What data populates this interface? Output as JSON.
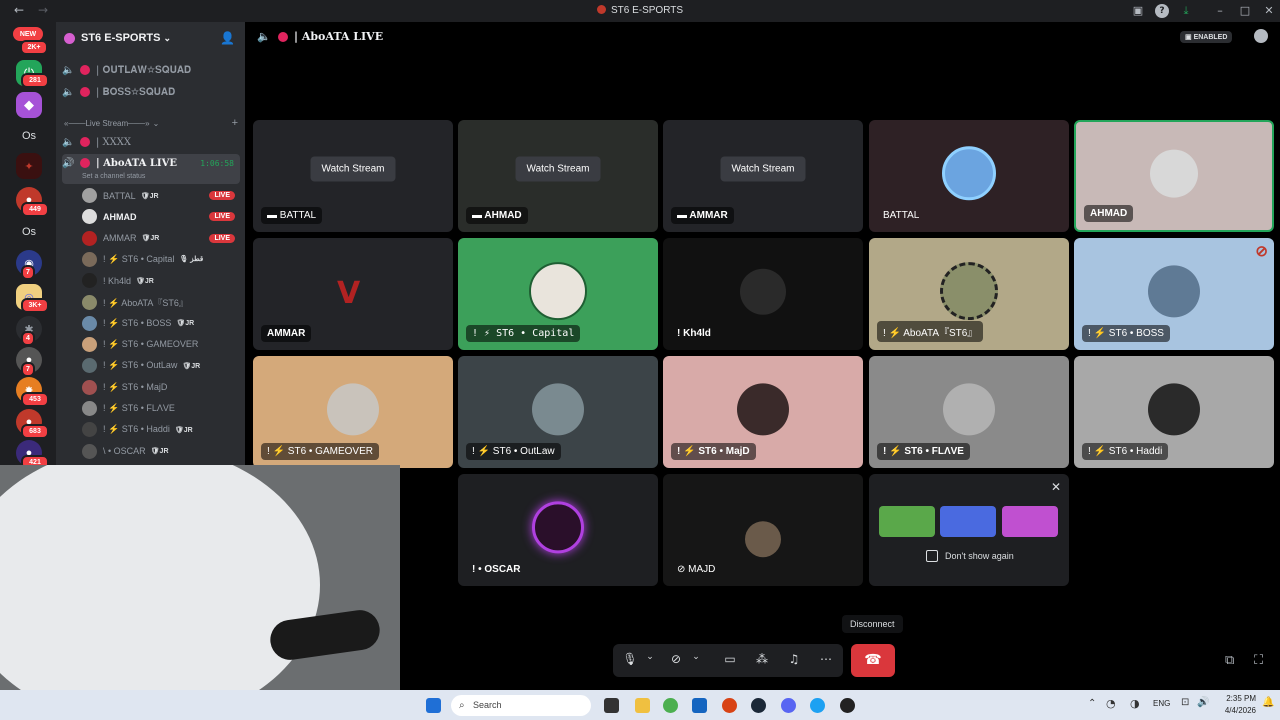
{
  "window": {
    "title": "ST6 E-SPORTS"
  },
  "server_badges": {
    "new": "NEW",
    "b1": "2K+",
    "b2": "281",
    "b3": "Os",
    "b4": "449",
    "b5": "Os",
    "b6": "7",
    "b7": "3K+",
    "b8": "4",
    "b9": "7",
    "b10": "453",
    "b11": "683",
    "b12": "421"
  },
  "guild": {
    "name": "ST6 E-SPORTS"
  },
  "channels": {
    "c1": "| 𝐎𝐔𝐓𝐋𝐀𝐖☆𝐒𝐐𝐔𝐀𝐃",
    "c2": "| 𝐁𝐎𝐒𝐒☆𝐒𝐐𝐔𝐀𝐃",
    "category": "«───Live Stream───»",
    "c3": "| XXXX",
    "c4": "| AboATA LIVE",
    "c4_timer": "1:06:58",
    "c4_status": "Set a channel status"
  },
  "members": [
    {
      "name": "BATTAL",
      "tag": "🛡JR",
      "live": "LIVE"
    },
    {
      "name": "AHMAD",
      "tag": "",
      "live": "LIVE"
    },
    {
      "name": "AMMAR",
      "tag": "🛡JR",
      "live": "LIVE"
    },
    {
      "name": "! ⚡ ST6 • Capital",
      "tag": "🎙 قطز",
      "live": ""
    },
    {
      "name": "! Kh4ld",
      "tag": "🛡JR",
      "live": ""
    },
    {
      "name": "! ⚡ AboATA『ST6』",
      "tag": "",
      "live": ""
    },
    {
      "name": "! ⚡ ST6 • BOSS",
      "tag": "🛡JR",
      "live": ""
    },
    {
      "name": "! ⚡ ST6 • GAMEOVER",
      "tag": "",
      "live": ""
    },
    {
      "name": "! ⚡ ST6 • OutLaw",
      "tag": "🛡JR",
      "live": ""
    },
    {
      "name": "! ⚡ ST6 • MajD",
      "tag": "",
      "live": ""
    },
    {
      "name": "! ⚡ ST6 • FLΛVE",
      "tag": "",
      "live": ""
    },
    {
      "name": "! ⚡ ST6 • Haddi",
      "tag": "🛡JR",
      "live": ""
    },
    {
      "name": "\\ • OSCAR",
      "tag": "🛡JR",
      "live": ""
    }
  ],
  "stage": {
    "channel": "| AboATA LIVE",
    "enabled": "ENABLED"
  },
  "tiles": {
    "watch": "Watch Stream",
    "t1": "BATTAL",
    "t2": "AHMAD",
    "t3": "AMMAR",
    "t4": "BATTAL",
    "t5": "AHMAD",
    "t6": "AMMAR",
    "t7": "! ⚡ ST6 • Capital",
    "t8": "! Kh4ld",
    "t9": "! ⚡ AboATA『ST6』",
    "t10": "! ⚡ ST6 • BOSS",
    "t11": "! ⚡ ST6 • GAMEOVER",
    "t12": "! ⚡ ST6 • OutLaw",
    "t13": "! ⚡ ST6 • MajD",
    "t14": "! ⚡ ST6 • FLΛVE",
    "t15": "! ⚡ ST6 • Haddi",
    "t16": "! • OSCAR",
    "t17": "MAJD"
  },
  "activity": {
    "dont_show": "Don't show again"
  },
  "controls": {
    "disconnect_tooltip": "Disconnect"
  },
  "taskbar": {
    "search": "Search",
    "lang": "ENG",
    "time": "2:35 PM",
    "date": "4/4/2026"
  }
}
